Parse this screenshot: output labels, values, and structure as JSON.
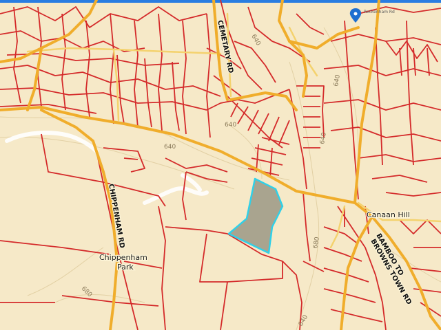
{
  "map": {
    "colors": {
      "background": "#f6e9c8",
      "parcel_line": "#d42a2a",
      "main_road": "#f2b233",
      "minor_road": "#f6d77a",
      "contour": "#e0cca0",
      "selected_fill": "#a9a48f",
      "selected_outline": "#30d0e8",
      "marker": "#1e6fd0"
    },
    "top_bar_color": "#2a7de1",
    "marker_icon": "map-pin-icon",
    "labels": {
      "cemetary_rd": "CEMETARY RD",
      "chippenham_rd": "CHIPPENHAM RD",
      "chippenham_park_line1": "Chippenham",
      "chippenham_park_line2": "Park",
      "canaan_hill": "Canaan Hill",
      "bamboo_to_browns_town_rd_1": "BAMBOO TO",
      "bamboo_to_browns_town_rd_2": "BROWNS TOWN RD",
      "marker_caption": "Reckenham Rd"
    },
    "contours": {
      "c640_a": "640",
      "c640_b": "640",
      "c640_c": "640",
      "c640_d": "640",
      "c640_e": "640",
      "c640_f": "640",
      "c680": "680",
      "c680_b": "680"
    }
  }
}
